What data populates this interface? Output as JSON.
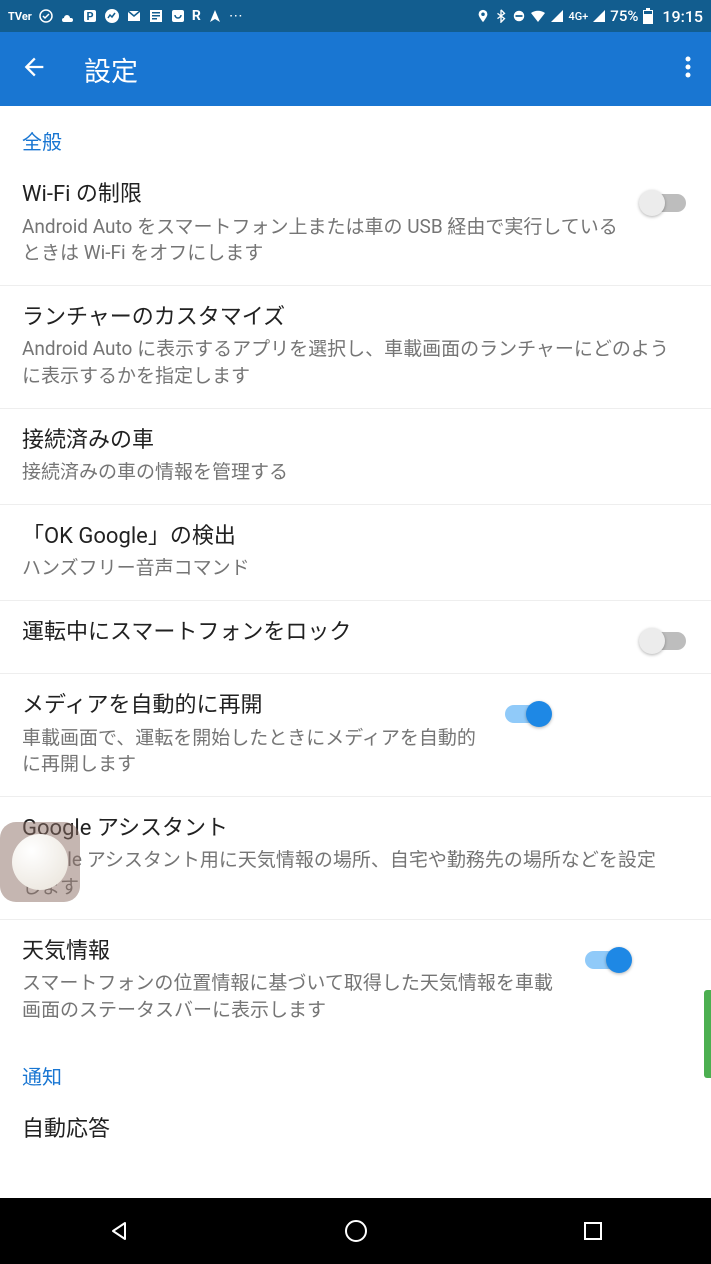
{
  "status": {
    "network_label": "4G+",
    "battery_pct": "75%",
    "time": "19:15"
  },
  "appbar": {
    "title": "設定"
  },
  "sections": {
    "general": "全般",
    "notifications": "通知"
  },
  "settings": {
    "wifi": {
      "title": "Wi-Fi の制限",
      "desc": "Android Auto をスマートフォン上または車の USB 経由で実行しているときは Wi-Fi をオフにします"
    },
    "launcher": {
      "title": "ランチャーのカスタマイズ",
      "desc": "Android Auto に表示するアプリを選択し、車載画面のランチャーにどのように表示するかを指定します"
    },
    "cars": {
      "title": "接続済みの車",
      "desc": "接続済みの車の情報を管理する"
    },
    "okgoogle": {
      "title": "「OK Google」の検出",
      "desc": "ハンズフリー音声コマンド"
    },
    "lock": {
      "title": "運転中にスマートフォンをロック"
    },
    "media": {
      "title": "メディアを自動的に再開",
      "desc": "車載画面で、運転を開始したときにメディアを自動的に再開します"
    },
    "assistant": {
      "title": "Google アシスタント",
      "desc": "Google アシスタント用に天気情報の場所、自宅や勤務先の場所などを設定します"
    },
    "weather": {
      "title": "天気情報",
      "desc": "スマートフォンの位置情報に基づいて取得した天気情報を車載画面のステータスバーに表示します"
    },
    "autoreply": {
      "title": "自動応答"
    }
  }
}
